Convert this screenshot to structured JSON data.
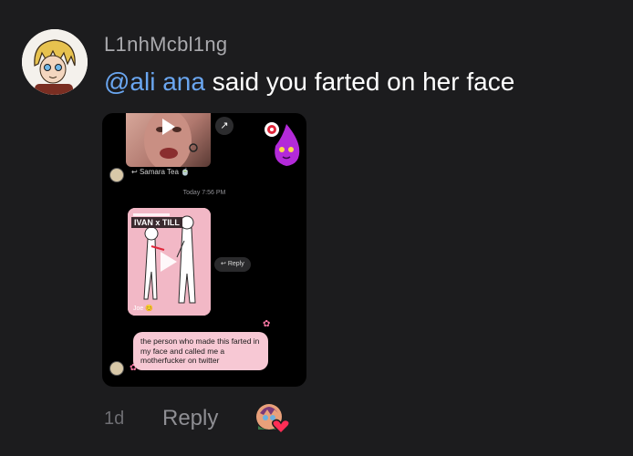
{
  "comment": {
    "username": "L1nhMcbl1ng",
    "mention": "@ali ana",
    "text": " said you farted on her face",
    "time_ago": "1d",
    "reply_label": "Reply"
  },
  "screenshot": {
    "story_sender": "Samara Tea",
    "timestamp": "Today 7:56 PM",
    "card_title": "IVAN x TILL",
    "card_sender": "Joe",
    "reply_chip": "Reply",
    "message": "the person who made this farted in my face and called me a motherfucker on twitter"
  },
  "colors": {
    "background": "#1c1c1e",
    "mention": "#6aa6f0",
    "bubble": "#f7c8d4",
    "heart": "#ff2d55"
  },
  "icons": {
    "play": "play-icon",
    "share": "share-arrow-icon",
    "reply": "reply-arrow-icon",
    "reaction": "heart-icon"
  }
}
